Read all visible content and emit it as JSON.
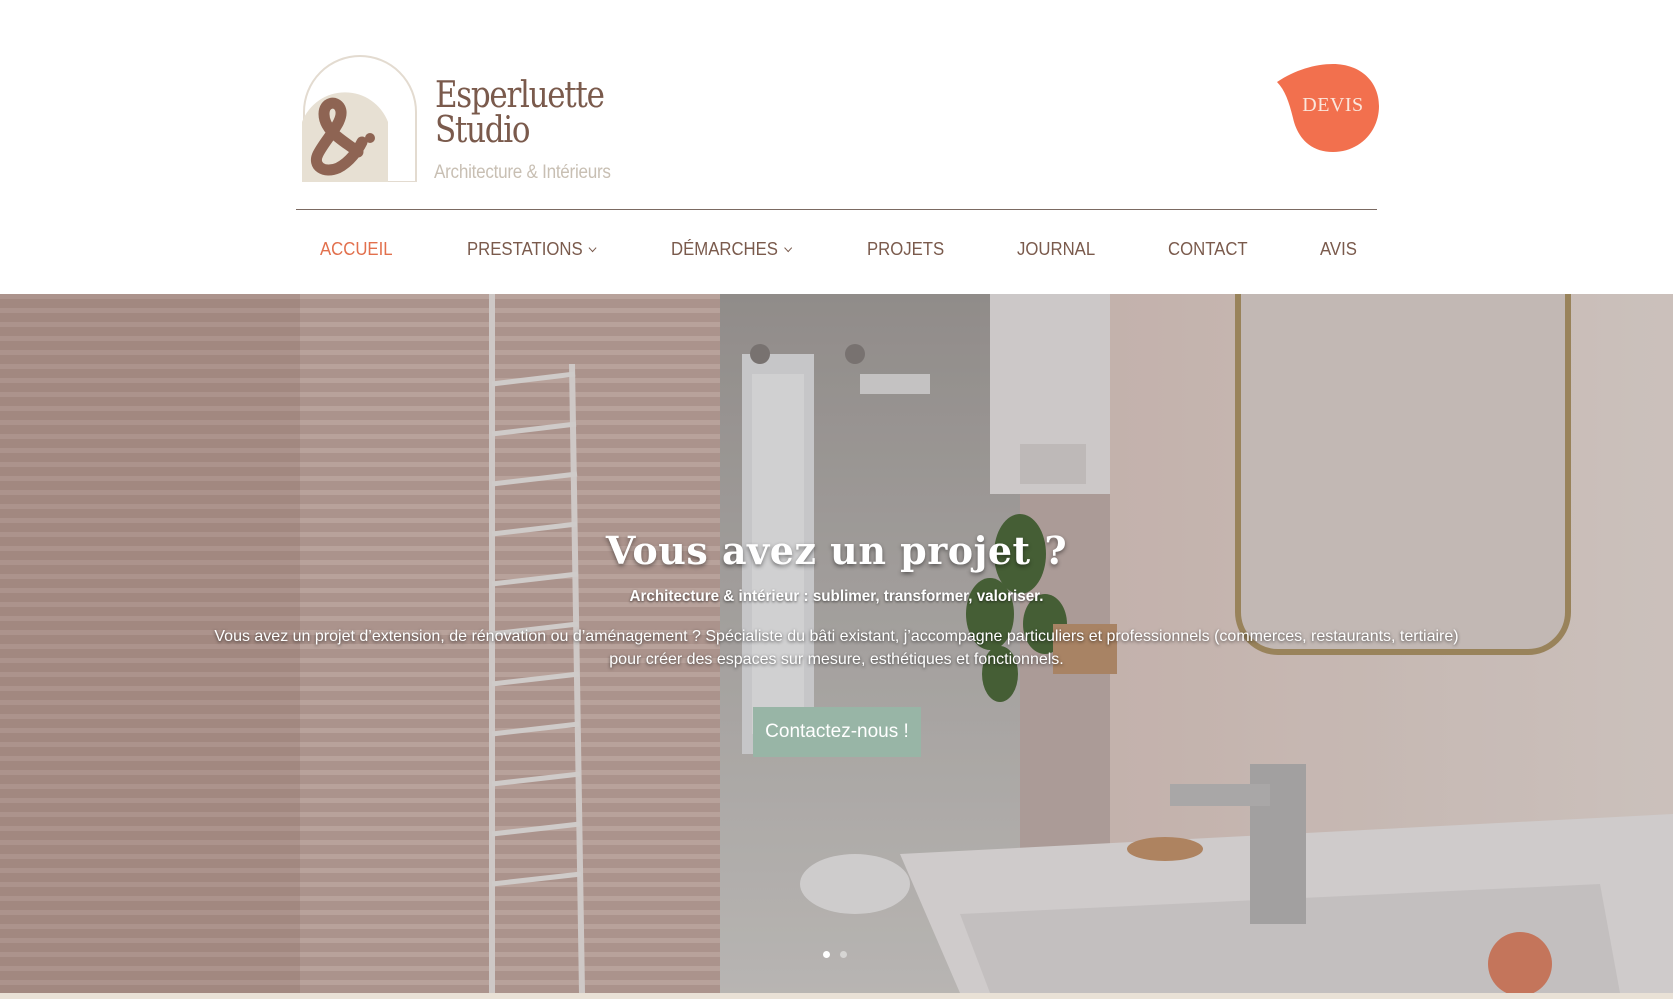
{
  "brand": {
    "name_line1": "Esperluette",
    "name_line2": "Studio",
    "tagline": "Architecture & Intérieurs",
    "colors": {
      "primary_brown": "#7a5a4c",
      "accent_orange": "#f2704e",
      "sage_green": "#98b5a6",
      "cream": "#e8e1d6"
    }
  },
  "header": {
    "devis_label": "DEVIS"
  },
  "nav": {
    "items": [
      {
        "label": "ACCUEIL",
        "active": true
      },
      {
        "label": "PRESTATIONS",
        "has_dropdown": true
      },
      {
        "label": "DÉMARCHES",
        "has_dropdown": true
      },
      {
        "label": "PROJETS"
      },
      {
        "label": "JOURNAL"
      },
      {
        "label": "CONTACT"
      },
      {
        "label": "AVIS"
      }
    ]
  },
  "hero": {
    "title": "Vous avez un projet ?",
    "subtitle": "Architecture & intérieur : sublimer, transformer, valoriser.",
    "body": "Vous avez un projet d’extension, de rénovation ou d’aménagement ? Spécialiste du bâti existant, j’accompagne particuliers et professionnels (commerces, restaurants, tertiaire) pour créer des espaces sur mesure, esthétiques et fonctionnels.",
    "cta_label": "Contactez-nous !",
    "slides_total": 2,
    "active_slide": 1
  }
}
